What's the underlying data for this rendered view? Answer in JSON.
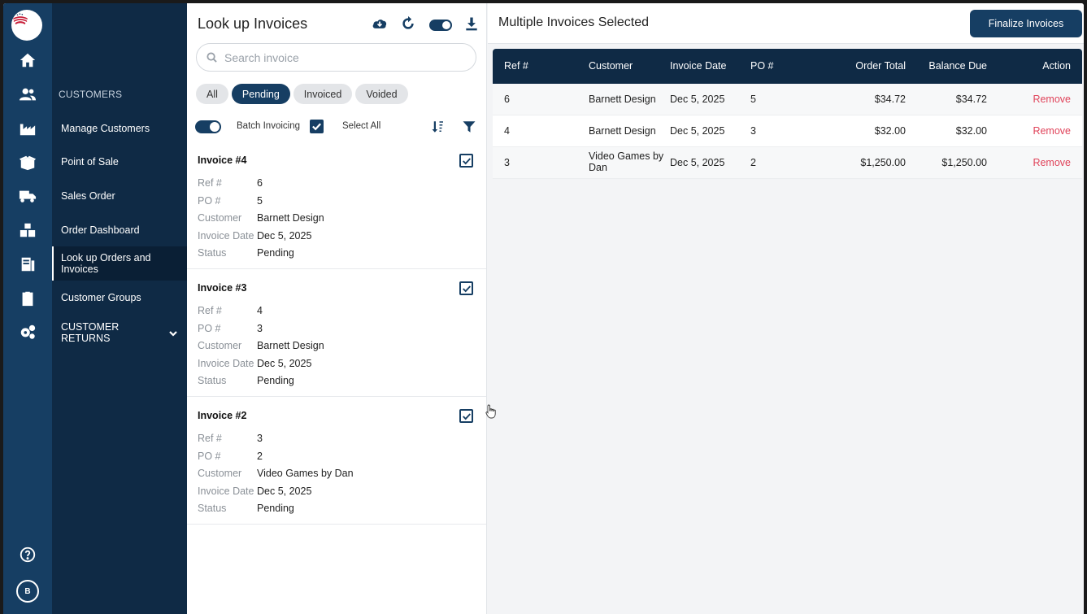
{
  "nav": {
    "section_label": "CUSTOMERS",
    "items": [
      {
        "label": "Manage Customers"
      },
      {
        "label": "Point of Sale"
      },
      {
        "label": "Sales Order"
      },
      {
        "label": "Order Dashboard"
      },
      {
        "label": "Look up Orders and Invoices",
        "active": true
      },
      {
        "label": "Customer Groups"
      },
      {
        "label": "CUSTOMER RETURNS"
      }
    ],
    "rail_icons": [
      "home-icon",
      "users-icon",
      "factory-icon",
      "box-icon",
      "truck-icon",
      "warehouse-icon",
      "invoice-icon",
      "clipboard-icon",
      "gears-icon",
      "help-icon"
    ],
    "avatar_initial": "B"
  },
  "panel": {
    "title": "Look up Invoices",
    "search_placeholder": "Search invoice",
    "filters": [
      "All",
      "Pending",
      "Invoiced",
      "Voided"
    ],
    "active_filter": "Pending",
    "batch_label": "Batch Invoicing",
    "select_all_label": "Select All",
    "field_labels": {
      "ref": "Ref #",
      "po": "PO #",
      "customer": "Customer",
      "invoice_date": "Invoice Date",
      "status": "Status"
    },
    "invoices": [
      {
        "title": "Invoice #4",
        "ref": "6",
        "po": "5",
        "customer": "Barnett Design",
        "invoice_date": "Dec 5, 2025",
        "status": "Pending",
        "checked": true
      },
      {
        "title": "Invoice #3",
        "ref": "4",
        "po": "3",
        "customer": "Barnett Design",
        "invoice_date": "Dec 5, 2025",
        "status": "Pending",
        "checked": true
      },
      {
        "title": "Invoice #2",
        "ref": "3",
        "po": "2",
        "customer": "Video Games by Dan",
        "invoice_date": "Dec 5, 2025",
        "status": "Pending",
        "checked": true
      }
    ]
  },
  "main": {
    "title": "Multiple Invoices Selected",
    "finalize_label": "Finalize Invoices",
    "columns": [
      "Ref #",
      "Customer",
      "Invoice Date",
      "PO #",
      "Order Total",
      "Balance Due",
      "Action"
    ],
    "rows": [
      {
        "ref": "6",
        "customer": "Barnett Design",
        "invoice_date": "Dec 5, 2025",
        "po": "5",
        "order_total": "$34.72",
        "balance_due": "$34.72",
        "action": "Remove"
      },
      {
        "ref": "4",
        "customer": "Barnett Design",
        "invoice_date": "Dec 5, 2025",
        "po": "3",
        "order_total": "$32.00",
        "balance_due": "$32.00",
        "action": "Remove"
      },
      {
        "ref": "3",
        "customer": "Video Games by Dan",
        "invoice_date": "Dec 5, 2025",
        "po": "2",
        "order_total": "$1,250.00",
        "balance_due": "$1,250.00",
        "action": "Remove"
      }
    ]
  },
  "colors": {
    "primary": "#163e63",
    "nav_bg": "#0f2a45",
    "remove": "#e0435a"
  }
}
